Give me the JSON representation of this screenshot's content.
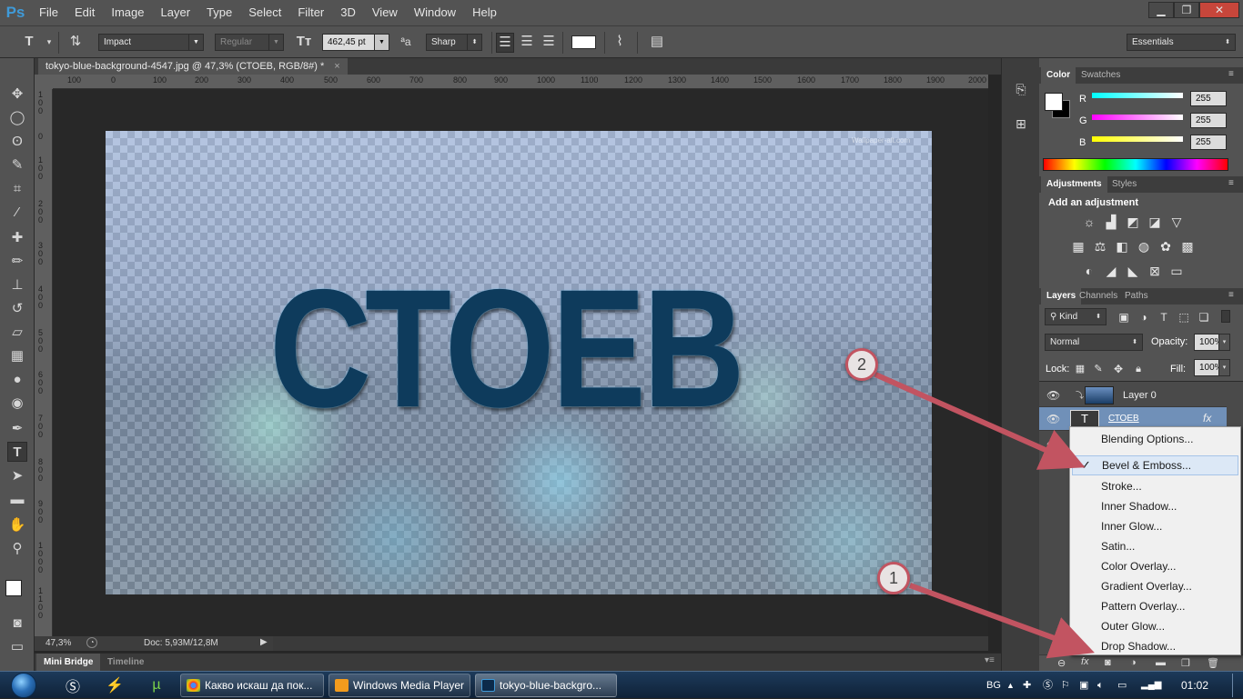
{
  "app": {
    "logo": "Ps"
  },
  "menu": [
    "File",
    "Edit",
    "Image",
    "Layer",
    "Type",
    "Select",
    "Filter",
    "3D",
    "View",
    "Window",
    "Help"
  ],
  "window_controls": {
    "minimize": "▁",
    "restore": "❐",
    "close": "✕"
  },
  "options": {
    "tool_glyph": "T",
    "font_family": "Impact",
    "font_style": "Regular",
    "font_size": "462,45 pt",
    "aa_label": "ªa",
    "antialias": "Sharp",
    "workspace": "Essentials"
  },
  "document": {
    "tab_title": "tokyo-blue-background-4547.jpg @ 47,3% (СТОЕВ, RGB/8#) *",
    "close": "×",
    "art_text": "СТОЕВ",
    "watermark": "Wallpaper-alt.com"
  },
  "ruler": {
    "h": [
      "100",
      "0",
      "100",
      "200",
      "300",
      "400",
      "500",
      "600",
      "700",
      "800",
      "900",
      "1000",
      "1100",
      "1200",
      "1300",
      "1400",
      "1500",
      "1600",
      "1700",
      "1800",
      "1900",
      "2000"
    ],
    "v": [
      "1 0 0",
      "0",
      "1 0 0",
      "2 0 0",
      "3 0 0",
      "4 0 0",
      "5 0 0",
      "6 0 0",
      "7 0 0",
      "8 0 0",
      "9 0 0",
      "1 0 0 0",
      "1 1 0 0"
    ]
  },
  "status": {
    "zoom": "47,3%",
    "doc": "Doc: 5,93M/12,8M"
  },
  "bottom_tabs": [
    "Mini Bridge",
    "Timeline"
  ],
  "color_panel": {
    "tabs": [
      "Color",
      "Swatches"
    ],
    "r_label": "R",
    "g_label": "G",
    "b_label": "B",
    "r": "255",
    "g": "255",
    "b": "255"
  },
  "adjustments": {
    "tabs": [
      "Adjustments",
      "Styles"
    ],
    "heading": "Add an adjustment"
  },
  "layers_panel": {
    "tabs": [
      "Layers",
      "Channels",
      "Paths"
    ],
    "kind": "Kind",
    "blend_mode": "Normal",
    "opacity_label": "Opacity:",
    "opacity": "100%",
    "lock_label": "Lock:",
    "fill_label": "Fill:",
    "fill": "100%",
    "layers": [
      {
        "name": "Layer 0"
      },
      {
        "name": "СТОЕВ",
        "fx": "fx"
      }
    ]
  },
  "context_menu": {
    "check": "✓",
    "items": [
      "Blending Options...",
      "Bevel & Emboss...",
      "Stroke...",
      "Inner Shadow...",
      "Inner Glow...",
      "Satin...",
      "Color Overlay...",
      "Gradient Overlay...",
      "Pattern Overlay...",
      "Outer Glow...",
      "Drop Shadow..."
    ]
  },
  "annotations": {
    "badge1": "1",
    "badge2": "2"
  },
  "taskbar": {
    "tasks": [
      "Какво искаш да пок...",
      "Windows Media Player",
      "tokyo-blue-backgro..."
    ],
    "lang": "BG",
    "time": "01:02"
  },
  "colors": {
    "ui_dark": "#535353",
    "accent_arrow": "#c25461",
    "ps_blue": "#3f9ad8"
  }
}
